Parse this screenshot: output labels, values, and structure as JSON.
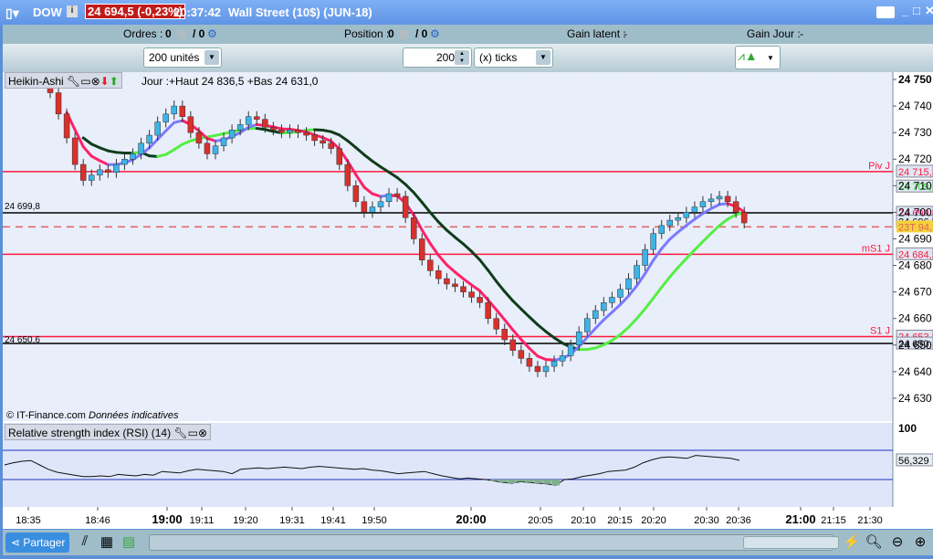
{
  "titlebar": {
    "symbol": "DOW",
    "price": "24 694,5 (-0,23%)",
    "time": "20:37:42",
    "instrument": "Wall Street (10$) (JUN-18)"
  },
  "orders": {
    "orders_label": "Ordres :",
    "orders_value": "0",
    "orders_slash": "/ 0",
    "position_label": "Position :",
    "position_value": "0",
    "position_slash": "/ 0",
    "gain_latent_label": "Gain latent :",
    "gain_latent_value": "-",
    "gain_jour_label": "Gain Jour :",
    "gain_jour_value": "-"
  },
  "toolbar": {
    "units_select": "200 unités",
    "ticks_value": "200",
    "ticks_select": "(x) ticks"
  },
  "chart": {
    "type_label": "Heikin-Ashi",
    "day_info": "Jour :+Haut 24 836,5 +Bas 24 631,0",
    "copyright": "© IT-Finance.com",
    "disclaimer": "Données indicatives",
    "left_label_1": "24 699,8",
    "left_label_2": "24 650,6"
  },
  "chart_data": {
    "type": "candlestick",
    "price_axis": {
      "ticks": [
        "24 750",
        "24 740",
        "24 730",
        "24 720",
        "24 710",
        "24 700",
        "24 690",
        "24 680",
        "24 670",
        "24 660",
        "24 650",
        "24 640",
        "24 630"
      ],
      "range": [
        24630,
        24750
      ]
    },
    "closes": [
      24745,
      24737,
      24728,
      24718,
      24712,
      24714,
      24716,
      24715,
      24718,
      24720,
      24722,
      24726,
      24729,
      24734,
      24737,
      24740,
      24736,
      24730,
      24726,
      24722,
      24725,
      24728,
      24731,
      24733,
      24736,
      24735,
      24732,
      24731,
      24730,
      24731,
      24730,
      24729,
      24727,
      24726,
      24724,
      24718,
      24710,
      24704,
      24700,
      24702,
      24704,
      24707,
      24706,
      24698,
      24690,
      24682,
      24678,
      24675,
      24673,
      24672,
      24670,
      24668,
      24666,
      24660,
      24656,
      24652,
      24648,
      24645,
      24642,
      24640,
      24642,
      24644,
      24646,
      24650,
      24655,
      24660,
      24663,
      24666,
      24668,
      24671,
      24675,
      24680,
      24686,
      24692,
      24695,
      24697,
      24698,
      24700,
      24702,
      24704,
      24705,
      24706,
      24704,
      24700,
      24696
    ],
    "levels": [
      {
        "name": "Piv J",
        "value": 24715.3,
        "label": "24 715,3",
        "color": "#ff1a3c"
      },
      {
        "name": "",
        "value": 24709.7,
        "label": "24 709,7",
        "color": "#33dd33",
        "axis_only": true
      },
      {
        "name": "",
        "value": 24699.8,
        "label": "24 699,8",
        "color": "#000000",
        "label_color": "#ff1a6a"
      },
      {
        "name": "",
        "value": 24696.5,
        "label": "24 696,5",
        "color": "#000000",
        "axis_only": true
      },
      {
        "name": "",
        "value": 24694.5,
        "label": "23T 94,5",
        "color": "#e06060",
        "dashed": true
      },
      {
        "name": "mS1 J",
        "value": 24684.2,
        "label": "24 684,2",
        "color": "#ff1a3c"
      },
      {
        "name": "S1 J",
        "value": 24653.2,
        "label": "24 653,2",
        "color": "#ff1a3c"
      },
      {
        "name": "",
        "value": 24650.6,
        "label": "24 650",
        "color": "#000000"
      }
    ],
    "rsi": {
      "title": "Relative strength index (RSI) (14)",
      "top_tick": "100",
      "upper": 70,
      "lower": 30,
      "last": "56,329",
      "values": [
        50,
        53,
        55,
        56,
        50,
        44,
        40,
        38,
        36,
        34,
        34,
        35,
        34,
        37,
        36,
        35,
        37,
        36,
        41,
        40,
        39,
        42,
        44,
        43,
        42,
        41,
        38,
        44,
        45,
        46,
        45,
        46,
        47,
        46,
        45,
        47,
        48,
        47,
        46,
        45,
        44,
        45,
        43,
        42,
        40,
        38,
        39,
        40,
        41,
        38,
        35,
        33,
        31,
        32,
        31,
        30,
        28,
        26,
        25,
        27,
        26,
        25,
        24,
        22,
        30,
        31,
        34,
        36,
        38,
        41,
        42,
        43,
        47,
        53,
        57,
        60,
        61,
        60,
        59,
        63,
        62,
        61,
        60,
        59,
        56.3
      ]
    },
    "time_axis": [
      "18:35",
      "18:46",
      "19:00",
      "19:11",
      "19:20",
      "19:31",
      "19:41",
      "19:50",
      "20:00",
      "20:05",
      "20:10",
      "20:15",
      "20:20",
      "20:30",
      "20:36",
      "21:00",
      "21:15",
      "21:30"
    ]
  },
  "bottom": {
    "share_label": "Partager"
  }
}
